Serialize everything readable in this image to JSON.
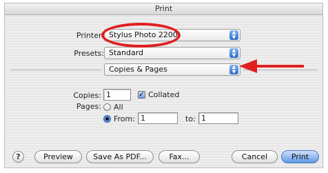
{
  "window": {
    "title": "Print"
  },
  "printer": {
    "label": "Printer:",
    "value": "Stylus Photo 2200"
  },
  "presets": {
    "label": "Presets:",
    "value": "Standard"
  },
  "section": {
    "value": "Copies & Pages"
  },
  "copies": {
    "label": "Copies:",
    "value": "1",
    "collated_label": "Collated",
    "collated_checked": true
  },
  "pages": {
    "label": "Pages:",
    "all_label": "All",
    "from_label": "From:",
    "from_value": "1",
    "to_label": "to:",
    "to_value": "1",
    "selected": "from"
  },
  "buttons": {
    "help": "?",
    "preview": "Preview",
    "save_pdf": "Save As PDF...",
    "fax": "Fax...",
    "cancel": "Cancel",
    "print": "Print"
  },
  "annotation_color": "#e11f1f"
}
